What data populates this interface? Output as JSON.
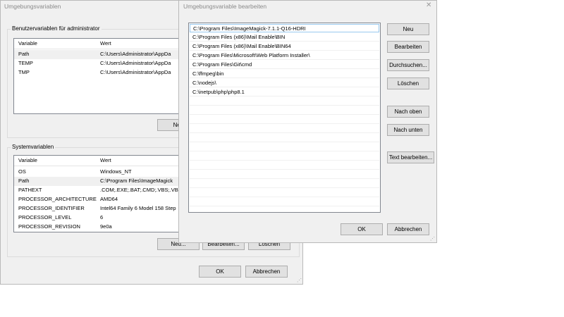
{
  "background_window": {
    "title": "Umgebungsvariablen",
    "user_group_label": "Benutzervariablen für administrator",
    "columns": [
      "Variable",
      "Wert"
    ],
    "user_vars": [
      {
        "name": "Path",
        "value": "C:\\Users\\Administrator\\AppDa"
      },
      {
        "name": "TEMP",
        "value": "C:\\Users\\Administrator\\AppDa"
      },
      {
        "name": "TMP",
        "value": "C:\\Users\\Administrator\\AppDa"
      }
    ],
    "user_new_button": "Neu",
    "system_group_label": "Systemvariablen",
    "system_vars": [
      {
        "name": "OS",
        "value": "Windows_NT"
      },
      {
        "name": "Path",
        "value": "C:\\Program Files\\ImageMagick"
      },
      {
        "name": "PATHEXT",
        "value": ".COM;.EXE;.BAT;.CMD;.VBS;.VBI"
      },
      {
        "name": "PROCESSOR_ARCHITECTURE",
        "value": "AMD64"
      },
      {
        "name": "PROCESSOR_IDENTIFIER",
        "value": "Intel64 Family 6 Model 158 Step"
      },
      {
        "name": "PROCESSOR_LEVEL",
        "value": "6"
      },
      {
        "name": "PROCESSOR_REVISION",
        "value": "9e0a"
      }
    ],
    "system_buttons": {
      "new": "Neu...",
      "edit": "Bearbeiten...",
      "delete": "Löschen"
    },
    "ok": "OK",
    "cancel": "Abbrechen"
  },
  "edit_dialog": {
    "title": "Umgebungsvariable bearbeiten",
    "entries": [
      "C:\\Program Files\\ImageMagick-7.1.1-Q16-HDRI",
      "C:\\Program Files (x86)\\Mail Enable\\BIN",
      "C:\\Program Files (x86)\\Mail Enable\\BIN64",
      "C:\\Program Files\\Microsoft\\Web Platform Installer\\",
      "C:\\Program Files\\Git\\cmd",
      "C:\\ffmpeg\\bin",
      "C:\\nodejs\\",
      "C:\\inetpub\\php\\php8.1"
    ],
    "buttons": {
      "new": "Neu",
      "edit": "Bearbeiten",
      "browse": "Durchsuchen...",
      "delete": "Löschen",
      "move_up": "Nach oben",
      "move_down": "Nach unten",
      "edit_text": "Text bearbeiten..."
    },
    "ok": "OK",
    "cancel": "Abbrechen"
  }
}
